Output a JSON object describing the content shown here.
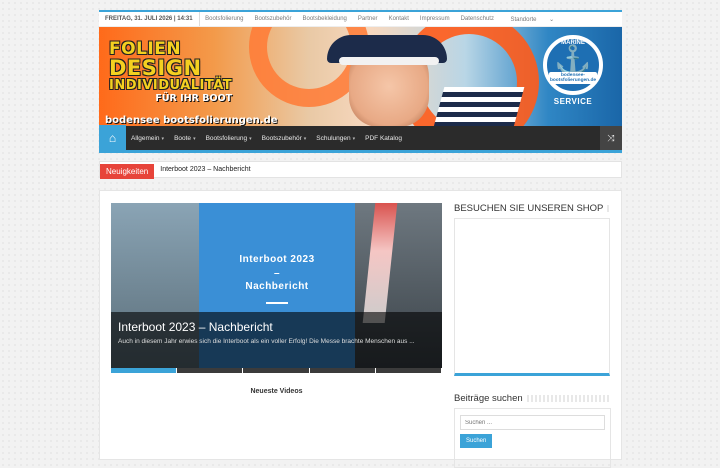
{
  "topbar": {
    "date": "FREITAG, 31. JULI 2026 | 14:31",
    "links": [
      "Bootsfolierung",
      "Bootszubehör",
      "Bootsbekleidung",
      "Partner",
      "Kontakt",
      "Impressum",
      "Datenschutz",
      "Standorte"
    ],
    "standorte_caret": "⌄"
  },
  "banner": {
    "line1": "FOLIEN",
    "line2": "DESIGN",
    "line3": "INDIVIDUALITÄT",
    "line4": "FÜR IHR BOOT",
    "url": "bodensee bootsfolierungen.de",
    "badge_top": "MARINE",
    "badge_url": "bodensee-bootsfolierungen.de",
    "badge_bottom": "SERVICE",
    "anchor_icon": "anchor-icon"
  },
  "mainnav": {
    "home_icon": "⌂",
    "items": [
      {
        "label": "Allgemein",
        "caret": "▾"
      },
      {
        "label": "Boote",
        "caret": "▾"
      },
      {
        "label": "Bootsfolierung",
        "caret": "▾"
      },
      {
        "label": "Bootszubehör",
        "caret": "▾"
      },
      {
        "label": "Schulungen",
        "caret": "▾"
      },
      {
        "label": "PDF Katalog",
        "caret": ""
      }
    ],
    "shuffle_icon": "⤨"
  },
  "ticker": {
    "label": "Neuigkeiten",
    "text": "Interboot 2023 – Nachbericht"
  },
  "slider": {
    "panel_line1": "Interboot 2023",
    "panel_line2": "–",
    "panel_line3": "Nachbericht",
    "title": "Interboot 2023 – Nachbericht",
    "excerpt": "Auch in diesem Jahr erwies sich die Interboot als ein voller Erfolg! Die Messe brachte Menschen aus ..."
  },
  "videos_heading": "Neueste Videos",
  "sidebar": {
    "shop_heading": "BESUCHEN SIE UNSEREN SHOP",
    "search_heading": "Beiträge suchen",
    "search_placeholder": "Suchen ...",
    "search_button": "Suchen"
  },
  "colors": {
    "accent": "#3ba3d8",
    "ticker_red": "#e7443a",
    "nav_dark": "#2b2b2b"
  }
}
